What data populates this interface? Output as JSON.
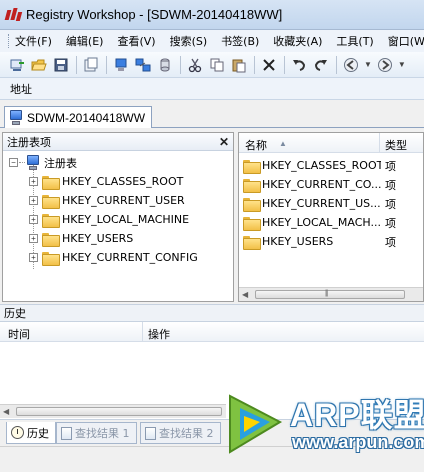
{
  "window": {
    "title": "Registry Workshop - [SDWM-20140418WW]"
  },
  "menubar": {
    "items": [
      "文件(F)",
      "编辑(E)",
      "查看(V)",
      "搜索(S)",
      "书签(B)",
      "收藏夹(A)",
      "工具(T)",
      "窗口(W"
    ]
  },
  "toolbar": {
    "icons": [
      "connect-icon",
      "open-icon",
      "save-icon",
      "export-icon",
      "registry-local-icon",
      "registry-remote-icon",
      "registry-file-icon",
      "cut-icon",
      "copy-icon",
      "paste-icon",
      "delete-icon",
      "undo-icon",
      "redo-icon",
      "back-icon",
      "forward-icon"
    ]
  },
  "address": {
    "label": "地址"
  },
  "doc_tab": {
    "label": "SDWM-20140418WW"
  },
  "tree_pane": {
    "title": "注册表项",
    "root": "注册表",
    "keys": [
      "HKEY_CLASSES_ROOT",
      "HKEY_CURRENT_USER",
      "HKEY_LOCAL_MACHINE",
      "HKEY_USERS",
      "HKEY_CURRENT_CONFIG"
    ]
  },
  "list_pane": {
    "columns": {
      "name": "名称",
      "type": "类型"
    },
    "rows": [
      {
        "name": "HKEY_CLASSES_ROOT",
        "type": "项"
      },
      {
        "name": "HKEY_CURRENT_CO...",
        "type": "项"
      },
      {
        "name": "HKEY_CURRENT_US...",
        "type": "项"
      },
      {
        "name": "HKEY_LOCAL_MACH...",
        "type": "项"
      },
      {
        "name": "HKEY_USERS",
        "type": "项"
      }
    ]
  },
  "history": {
    "title": "历史",
    "columns": {
      "time": "时间",
      "operation": "操作"
    }
  },
  "bottom_tabs": [
    {
      "label": "历史",
      "active": true
    },
    {
      "label": "查找结果 1",
      "active": false
    },
    {
      "label": "查找结果 2",
      "active": false
    }
  ],
  "watermark": {
    "brand": "ARP联盟",
    "url": "www.arpun.com"
  }
}
